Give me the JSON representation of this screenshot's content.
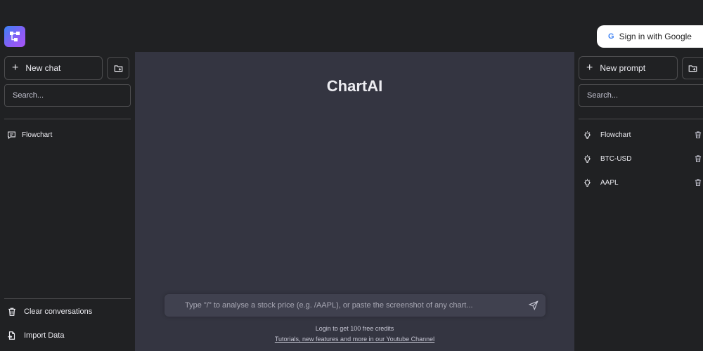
{
  "app": {
    "title": "ChartAI"
  },
  "auth": {
    "signin_label": "Sign in with Google",
    "google_glyph": "G"
  },
  "left_sidebar": {
    "new_chat_label": "New chat",
    "search_placeholder": "Search...",
    "conversations": [
      {
        "label": "Flowchart",
        "icon": "message-icon"
      }
    ],
    "bottom": {
      "clear_label": "Clear conversations",
      "import_label": "Import Data"
    }
  },
  "right_sidebar": {
    "new_prompt_label": "New prompt",
    "search_placeholder": "Search...",
    "prompts": [
      {
        "label": "Flowchart",
        "icon": "bulb-icon"
      },
      {
        "label": "BTC-USD",
        "icon": "bulb-icon"
      },
      {
        "label": "AAPL",
        "icon": "bulb-icon"
      }
    ]
  },
  "chat_input": {
    "placeholder": "Type \"/\" to analyse a stock price (e.g. /AAPL), or paste the screenshot of any chart..."
  },
  "footer": {
    "credits_text": "Login to get 100 free credits",
    "youtube_link": "Tutorials, new features and more in our Youtube Channel"
  },
  "colors": {
    "sidebar_bg": "#202123",
    "main_bg": "#343541",
    "input_bg": "#40414f",
    "border": "#4d4d4f",
    "text": "#ececf1",
    "logo_gradient_start": "#3b82f6",
    "logo_gradient_end": "#a855f7"
  }
}
